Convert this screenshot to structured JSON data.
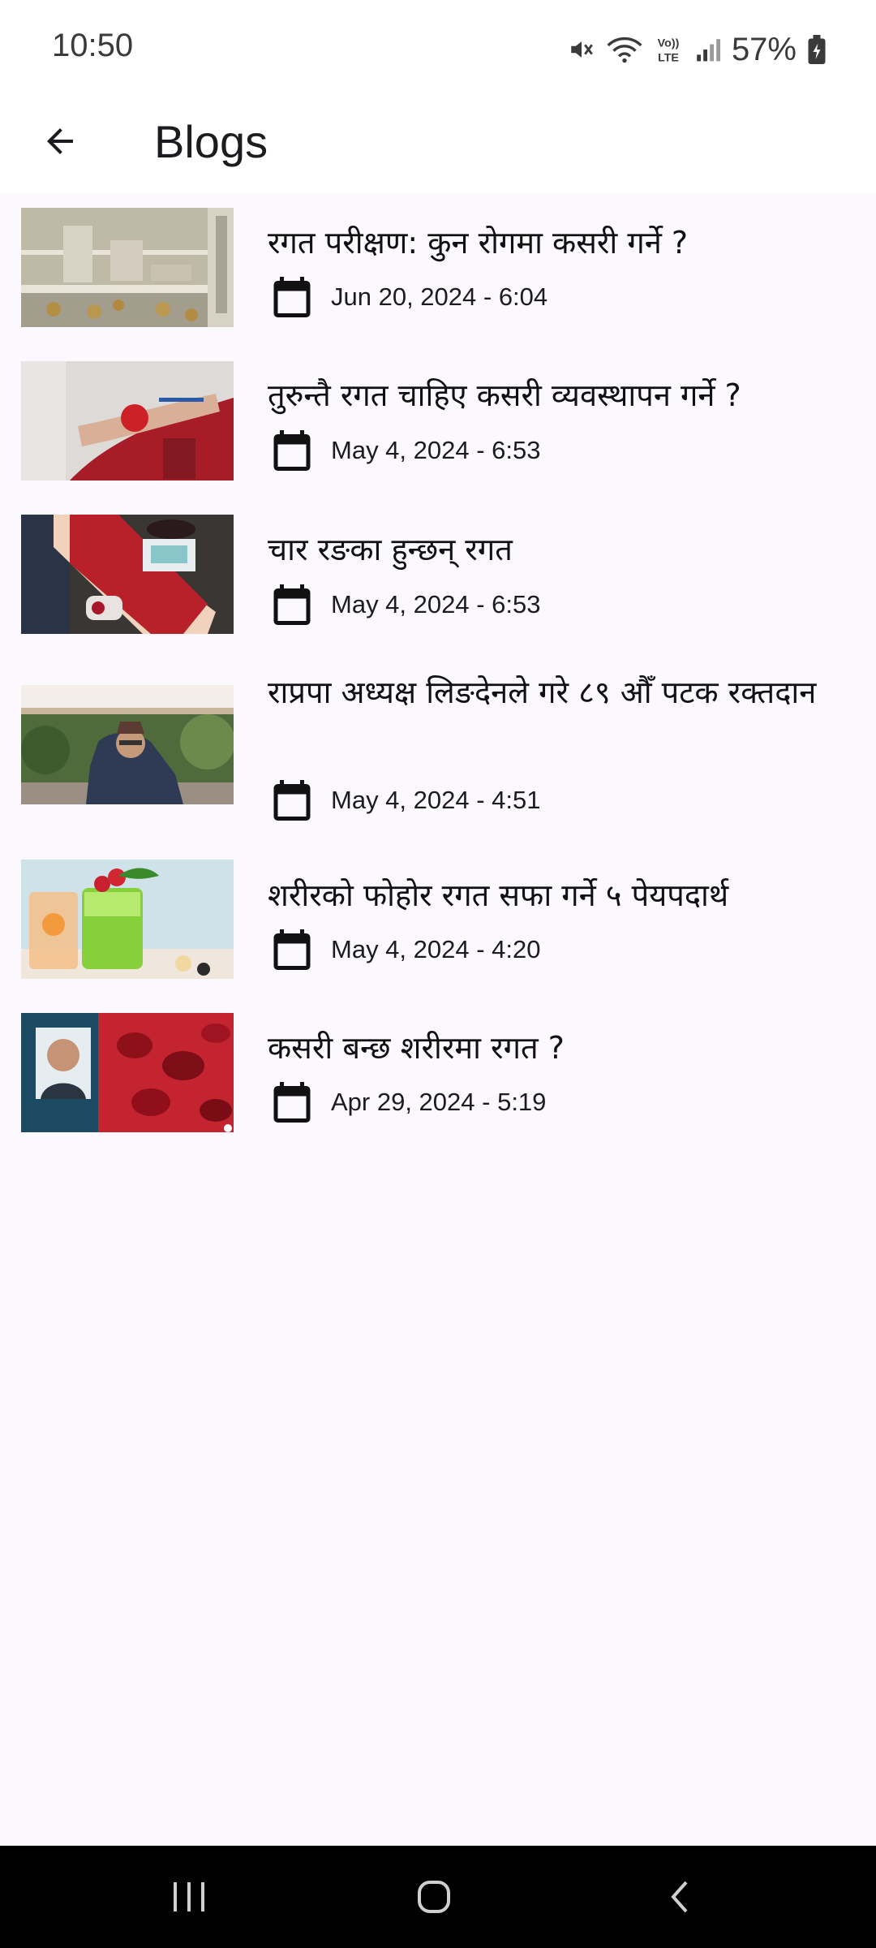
{
  "status_bar": {
    "time": "10:50",
    "battery": "57%",
    "icons": [
      "mute-icon",
      "wifi-icon",
      "volte-icon",
      "signal-icon",
      "battery-icon"
    ],
    "volte_label": "Vo)) LTE"
  },
  "app_bar": {
    "title": "Blogs",
    "back_icon": "arrow-left-icon"
  },
  "blogs": [
    {
      "title": "रगत परीक्षण: कुन रोगमा कसरी गर्ने ?",
      "date": "Jun 20, 2024 - 6:04",
      "image": "lab-blood-samples-thumbnail"
    },
    {
      "title": "तुरुन्तै रगत चाहिए कसरी व्यवस्थापन गर्ने ?",
      "date": "May 4, 2024 - 6:53",
      "image": "blood-donation-arm-thumbnail"
    },
    {
      "title": "चार रङका हुन्छन् रगत",
      "date": "May 4, 2024 - 6:53",
      "image": "blood-bag-donor-thumbnail"
    },
    {
      "title": "राप्रपा अध्यक्ष लिङदेनले गरे ८९ औँ पटक रक्तदान",
      "date": "May 4, 2024 - 4:51",
      "image": "leader-donating-thumbnail"
    },
    {
      "title": "शरीरको फोहोर रगत सफा गर्ने ५ पेयपदार्थ",
      "date": "May 4, 2024 - 4:20",
      "image": "detox-drinks-thumbnail"
    },
    {
      "title": "कसरी बन्छ शरीरमा रगत ?",
      "date": "Apr 29, 2024 - 5:19",
      "image": "doctor-blood-cells-thumbnail"
    }
  ],
  "nav_bar": {
    "recents": "recents-icon",
    "home": "home-icon",
    "back": "back-icon"
  },
  "colors": {
    "background": "#fbf9fd",
    "app_bar": "#ffffff",
    "text": "#1c1b1f",
    "nav_bar": "#000000"
  }
}
